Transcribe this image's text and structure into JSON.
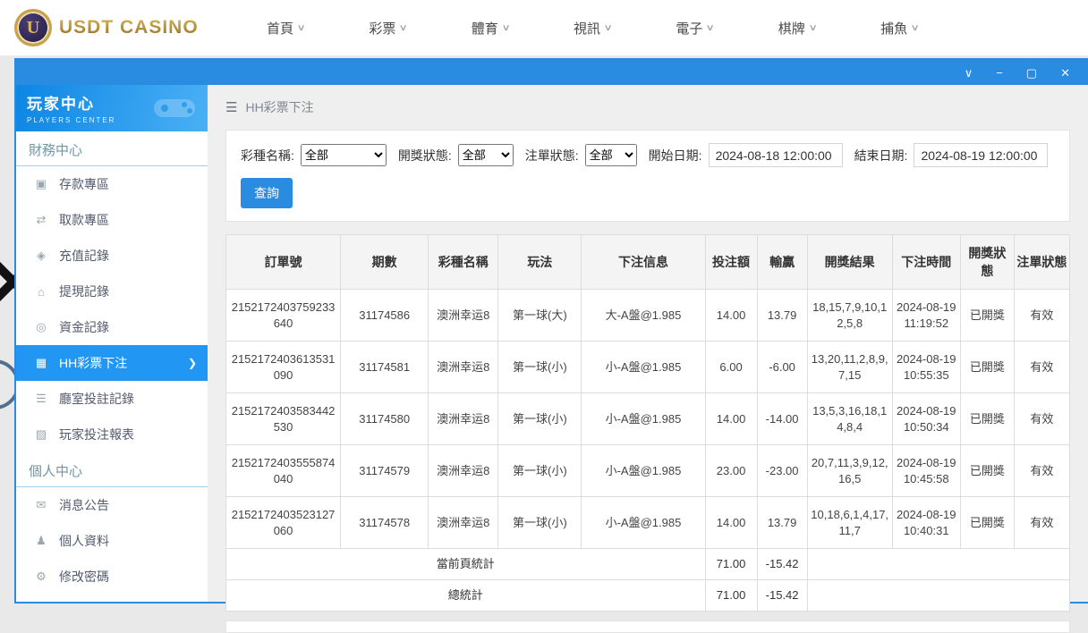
{
  "icons": {
    "chevron_down": "∨",
    "minimize": "−",
    "maximize": "▢",
    "close": "✕",
    "hamburger": "☰",
    "nav_caret": "∨"
  },
  "topnav": {
    "brand": "USDT CASINO",
    "brand_initial": "U",
    "items": [
      {
        "label": "首頁"
      },
      {
        "label": "彩票"
      },
      {
        "label": "體育"
      },
      {
        "label": "視訊"
      },
      {
        "label": "電子"
      },
      {
        "label": "棋牌"
      },
      {
        "label": "捕魚"
      }
    ]
  },
  "sidebar": {
    "title": "玩家中心",
    "subtitle": "PLAYERS CENTER",
    "sections": [
      {
        "header": "財務中心",
        "items": [
          {
            "label": "存款專區",
            "icon": "deposit-icon",
            "glyph": "▣",
            "active": false
          },
          {
            "label": "取款專區",
            "icon": "withdraw-icon",
            "glyph": "⇄",
            "active": false
          },
          {
            "label": "充值記錄",
            "icon": "recharge-record-icon",
            "glyph": "◈",
            "active": false
          },
          {
            "label": "提現記錄",
            "icon": "withdrawal-record-icon",
            "glyph": "⌂",
            "active": false
          },
          {
            "label": "資金記錄",
            "icon": "funds-record-icon",
            "glyph": "◎",
            "active": false
          },
          {
            "label": "HH彩票下注",
            "icon": "lottery-bets-icon",
            "glyph": "▦",
            "active": true
          },
          {
            "label": "廳室投註記錄",
            "icon": "room-bet-record-icon",
            "glyph": "☰",
            "active": false
          },
          {
            "label": "玩家投注報表",
            "icon": "player-bet-report-icon",
            "glyph": "▨",
            "active": false
          }
        ]
      },
      {
        "header": "個人中心",
        "items": [
          {
            "label": "消息公告",
            "icon": "announcement-icon",
            "glyph": "✉",
            "active": false
          },
          {
            "label": "個人資料",
            "icon": "profile-icon",
            "glyph": "♟",
            "active": false
          },
          {
            "label": "修改密碼",
            "icon": "change-password-icon",
            "glyph": "⚙",
            "active": false
          }
        ]
      }
    ]
  },
  "main": {
    "breadcrumb": "HH彩票下注",
    "filters": {
      "lottery_label": "彩種名稱:",
      "lottery_value": "全部",
      "draw_status_label": "開獎狀態:",
      "draw_status_value": "全部",
      "order_status_label": "注單狀態:",
      "order_status_value": "全部",
      "start_label": "開始日期:",
      "start_value": "2024-08-18 12:00:00",
      "end_label": "結束日期:",
      "end_value": "2024-08-19 12:00:00",
      "search_button": "查詢"
    },
    "table": {
      "headers": [
        "訂單號",
        "期數",
        "彩種名稱",
        "玩法",
        "下注信息",
        "投注額",
        "輸贏",
        "開獎結果",
        "下注時間",
        "開獎狀態",
        "注單狀態"
      ],
      "rows": [
        [
          "2152172403759233640",
          "31174586",
          "澳洲幸运8",
          "第一球(大)",
          "大-A盤@1.985",
          "14.00",
          "13.79",
          "18,15,7,9,10,12,5,8",
          "2024-08-19 11:19:52",
          "已開獎",
          "有效"
        ],
        [
          "2152172403613531090",
          "31174581",
          "澳洲幸运8",
          "第一球(小)",
          "小-A盤@1.985",
          "6.00",
          "-6.00",
          "13,20,11,2,8,9,7,15",
          "2024-08-19 10:55:35",
          "已開獎",
          "有效"
        ],
        [
          "2152172403583442530",
          "31174580",
          "澳洲幸运8",
          "第一球(小)",
          "小-A盤@1.985",
          "14.00",
          "-14.00",
          "13,5,3,16,18,14,8,4",
          "2024-08-19 10:50:34",
          "已開獎",
          "有效"
        ],
        [
          "2152172403555874040",
          "31174579",
          "澳洲幸运8",
          "第一球(小)",
          "小-A盤@1.985",
          "23.00",
          "-23.00",
          "20,7,11,3,9,12,16,5",
          "2024-08-19 10:45:58",
          "已開獎",
          "有效"
        ],
        [
          "2152172403523127060",
          "31174578",
          "澳洲幸运8",
          "第一球(小)",
          "小-A盤@1.985",
          "14.00",
          "13.79",
          "10,18,6,1,4,17,11,7",
          "2024-08-19 10:40:31",
          "已開獎",
          "有效"
        ]
      ],
      "summary_rows": [
        {
          "label": "當前頁統計",
          "bet_total": "71.00",
          "winloss_total": "-15.42"
        },
        {
          "label": "總統計",
          "bet_total": "71.00",
          "winloss_total": "-15.42"
        }
      ]
    }
  },
  "colors": {
    "accent_blue": "#2a8ce0",
    "active_item_blue": "#2196f3",
    "brand_gold": "#b8902f"
  }
}
